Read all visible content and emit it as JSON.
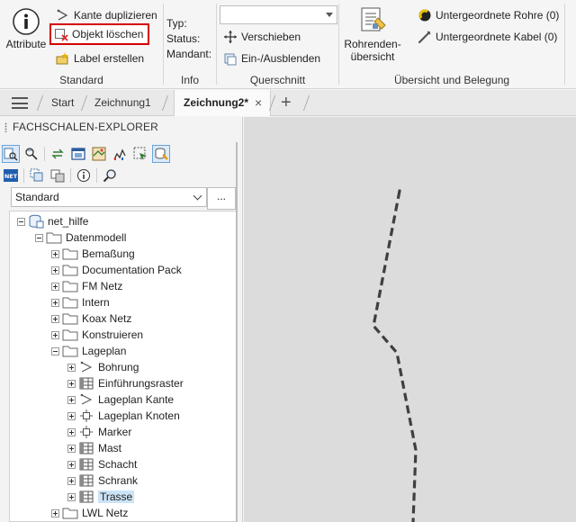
{
  "ribbon": {
    "standard": {
      "group_label": "Standard",
      "attribute_label": "Attribute",
      "kante_duplizieren": "Kante duplizieren",
      "objekt_loeschen": "Objekt löschen",
      "label_erstellen": "Label erstellen"
    },
    "info": {
      "group_label": "Info",
      "typ": "Typ:",
      "status": "Status:",
      "mandant": "Mandant:"
    },
    "querschnitt": {
      "group_label": "Querschnitt",
      "select_value": "",
      "verschieben": "Verschieben",
      "ein_ausblenden": "Ein-/Ausblenden"
    },
    "uebersicht": {
      "group_label": "Übersicht und Belegung",
      "rohrenden_line1": "Rohrenden-",
      "rohrenden_line2": "übersicht",
      "untergeordnete_rohre": "Untergeordnete Rohre (0)",
      "untergeordnete_kabel": "Untergeordnete Kabel (0)"
    }
  },
  "tabs": {
    "start": "Start",
    "zeichnung1": "Zeichnung1",
    "zeichnung2": "Zeichnung2*",
    "close": "×",
    "add": "+"
  },
  "explorer": {
    "title": "FACHSCHALEN-EXPLORER",
    "select_value": "Standard",
    "dots": "...",
    "tree": {
      "root": "net_hilfe",
      "datenmodell": "Datenmodell",
      "folders": [
        "Bemaßung",
        "Documentation Pack",
        "FM Netz",
        "Intern",
        "Koax Netz",
        "Konstruieren",
        "Lageplan"
      ],
      "lageplan_children": [
        "Bohrung",
        "Einführungsraster",
        "Lageplan Kante",
        "Lageplan Knoten",
        "Marker",
        "Mast",
        "Schacht",
        "Schrank",
        "Trasse"
      ],
      "last_folder": "LWL Netz"
    }
  },
  "colors": {
    "highlight": "#d40000",
    "selection": "#cce4f7",
    "canvas_bg": "#dcdcdc",
    "polyline": "#444444"
  }
}
